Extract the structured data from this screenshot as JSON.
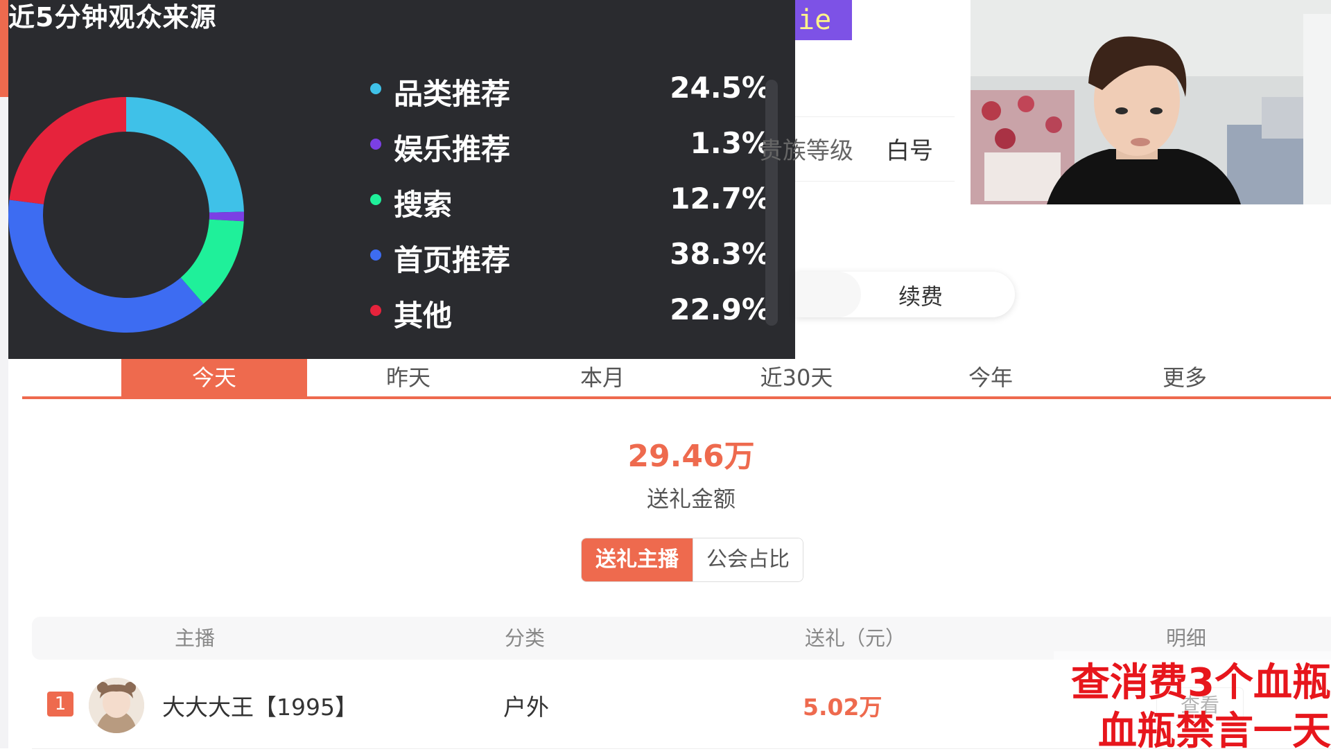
{
  "overlay": {
    "title": "近5分钟观众来源",
    "sources": [
      {
        "label": "品类推荐",
        "percent": "24.5%",
        "value": 24.5,
        "color": "#3fc1e8"
      },
      {
        "label": "娱乐推荐",
        "percent": "1.3%",
        "value": 1.3,
        "color": "#7b3fe4"
      },
      {
        "label": "搜索",
        "percent": "12.7%",
        "value": 12.7,
        "color": "#1ff09a"
      },
      {
        "label": "首页推荐",
        "percent": "38.3%",
        "value": 38.3,
        "color": "#3d6cf2"
      },
      {
        "label": "其他",
        "percent": "22.9%",
        "value": 22.9,
        "color": "#e6233c"
      }
    ]
  },
  "header": {
    "badge_text": "ie",
    "level_label": "贵族等级",
    "whitename_label": "白号",
    "renew_label": "续费"
  },
  "tabs": [
    "今天",
    "昨天",
    "本月",
    "近30天",
    "今年",
    "更多"
  ],
  "active_tab": "今天",
  "summary": {
    "amount": "29.46万",
    "amount_label": "送礼金额"
  },
  "segmented": {
    "active": "送礼主播",
    "other": "公会占比"
  },
  "table": {
    "headers": [
      "主播",
      "分类",
      "送礼（元）",
      "明细"
    ],
    "rows": [
      {
        "rank": "1",
        "name": "大大大王【1995】",
        "category": "户外",
        "gift": "5.02万",
        "detail": "查看"
      }
    ]
  },
  "stream_notice": {
    "line1": "查消费3个血瓶",
    "line2": "血瓶禁言一天"
  },
  "colors": {
    "accent": "#ee6a4e",
    "overlay_bg": "#2a2b2f",
    "notice_red": "#e7161c"
  }
}
